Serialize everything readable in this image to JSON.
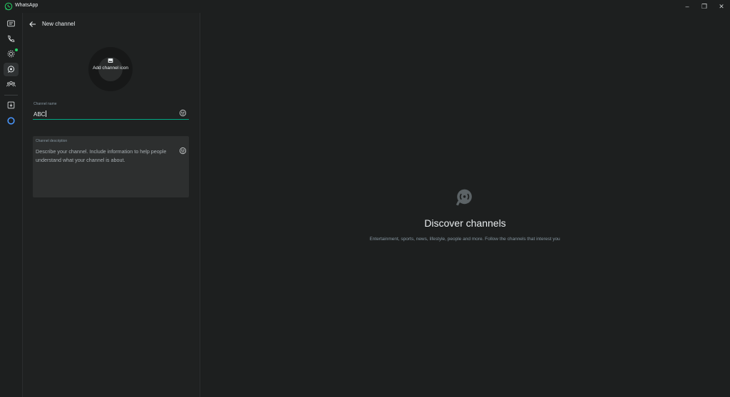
{
  "titlebar": {
    "app_title": "WhatsApp",
    "minimize_glyph": "–",
    "maximize_glyph": "❐",
    "close_glyph": "✕"
  },
  "rail": {
    "items": [
      {
        "icon": "chats-icon"
      },
      {
        "icon": "calls-icon"
      },
      {
        "icon": "status-icon"
      },
      {
        "icon": "channels-icon"
      },
      {
        "icon": "communities-icon"
      },
      {
        "icon": "archive-icon"
      },
      {
        "icon": "meta-ai-icon"
      }
    ],
    "accent": "#25d366"
  },
  "panel": {
    "title": "New channel",
    "avatar_label": "Add channel icon",
    "name_label": "Channel name",
    "name_value": "ABC",
    "description_label": "Channel description",
    "description_placeholder": "Describe your channel. Include information to help people understand what your channel is about."
  },
  "main": {
    "title": "Discover channels",
    "subtitle": "Entertainment, sports, news, lifestyle, people and more. Follow the channels that interest you"
  },
  "colors": {
    "accent": "#00a884",
    "background": "#1d1f1f",
    "panel": "#1f2121",
    "input_bg": "#2d2f2f"
  }
}
